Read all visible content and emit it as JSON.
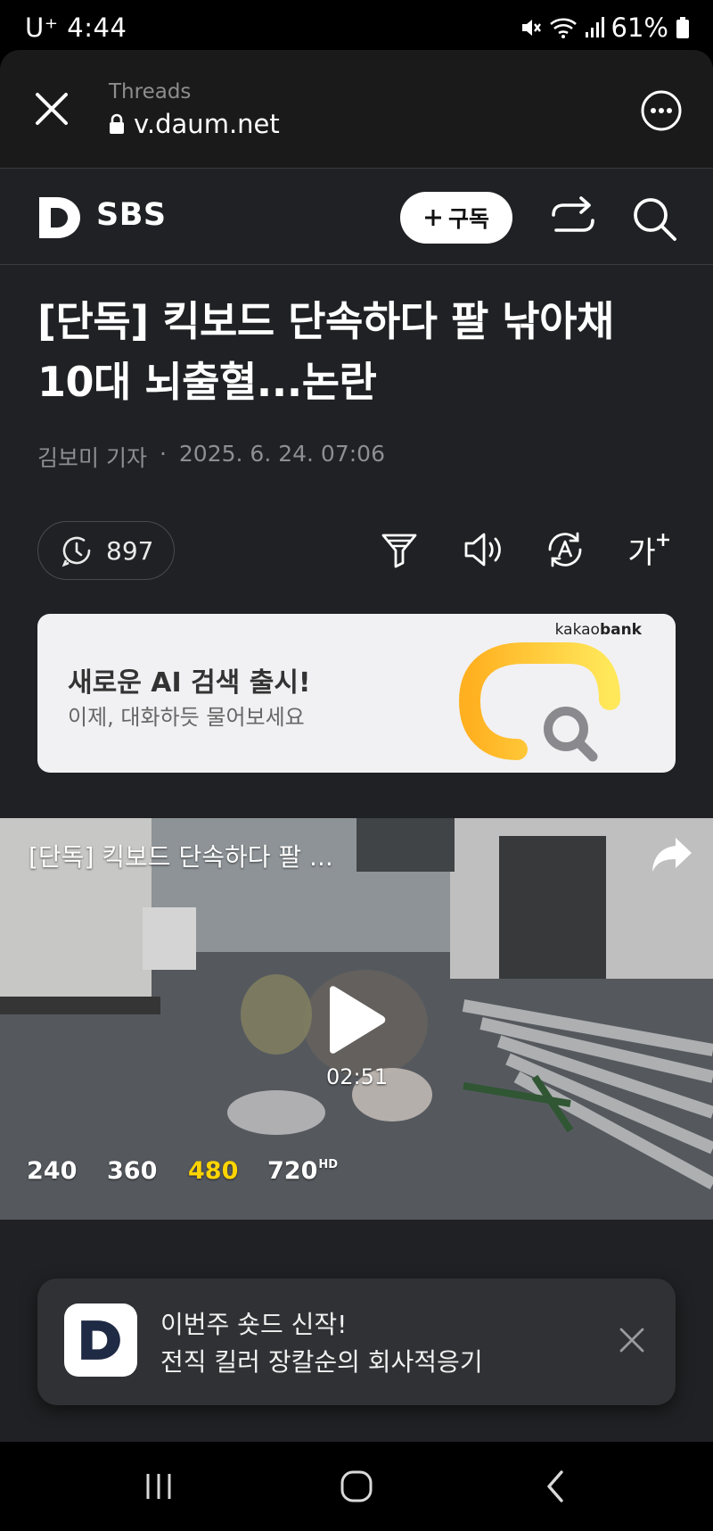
{
  "status_bar": {
    "carrier": "U⁺",
    "time": "4:44",
    "battery": "61%"
  },
  "browser": {
    "origin": "Threads",
    "url": "v.daum.net"
  },
  "header": {
    "press": "SBS",
    "subscribe_label": "구독"
  },
  "article": {
    "headline_line1": "[단독] 킥보드 단속하다 팔 낚아채",
    "headline_line2": "10대 뇌출혈...논란",
    "reporter": "김보미 기자",
    "separator": "·",
    "date": "2025. 6. 24. 07:06",
    "view_count": "897",
    "font_tool_label": "가"
  },
  "ad": {
    "brand_prefix": "kakao",
    "brand_suffix": "bank",
    "title": "새로운 AI 검색 출시!",
    "description": "이제, 대화하듯 물어보세요"
  },
  "video": {
    "title": "[단독] 킥보드 단속하다 팔 ...",
    "duration": "02:51",
    "quality_options": [
      "240",
      "360",
      "480",
      "720"
    ],
    "selected_quality": "480",
    "hd_badge": "HD"
  },
  "toast": {
    "line1": "이번주 숏드 신작!",
    "line2": "전직 킬러 장칼순의 회사적응기"
  },
  "icons": {
    "close": "close-icon",
    "more": "more-icon",
    "lock": "lock-icon",
    "share": "share-icon",
    "search": "search-icon",
    "views": "views-icon",
    "filter": "filter-icon",
    "audio": "speaker-icon",
    "translate": "translate-icon"
  },
  "colors": {
    "app_bg": "#202124",
    "accent_quality": "#ffd400",
    "ad_bg": "#f1f1f3",
    "toast_bg": "#303134"
  }
}
